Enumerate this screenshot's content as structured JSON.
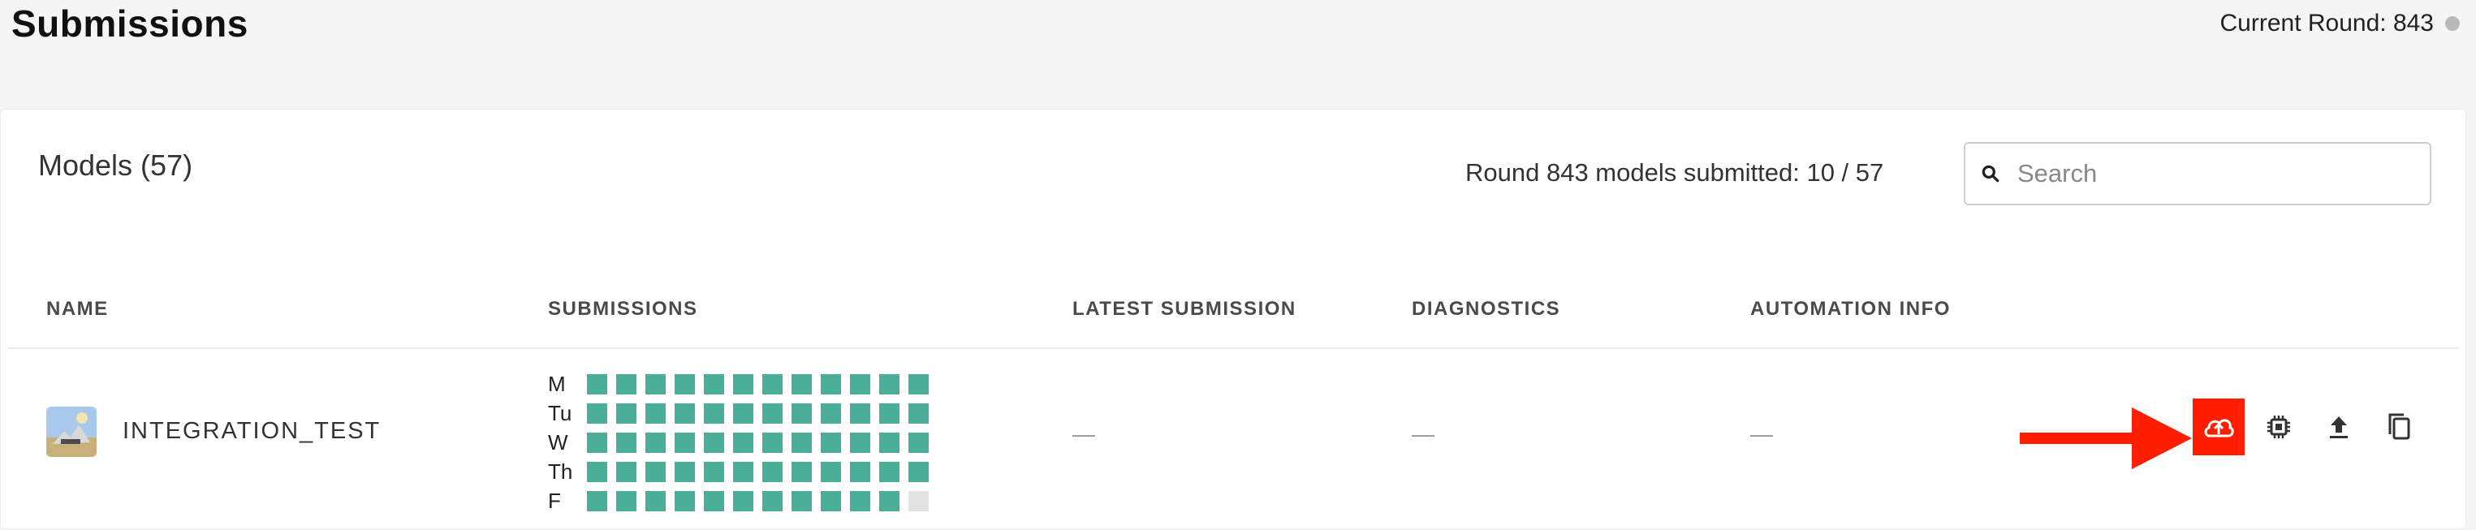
{
  "page": {
    "title": "Submissions"
  },
  "round": {
    "label": "Current Round: 843"
  },
  "models_card": {
    "title": "Models (57)",
    "submitted_status": "Round 843 models submitted: 10 / 57",
    "search": {
      "placeholder": "Search",
      "value": ""
    }
  },
  "table": {
    "columns": {
      "name": "NAME",
      "submissions": "SUBMISSIONS",
      "latest": "LATEST SUBMISSION",
      "diagnostics": "DIAGNOSTICS",
      "automation": "AUTOMATION INFO"
    },
    "rows": [
      {
        "name": "INTEGRATION_TEST",
        "latest_submission": "—",
        "diagnostics": "—",
        "automation_info": "—",
        "submissions": {
          "days": [
            "M",
            "Tu",
            "W",
            "Th",
            "F"
          ],
          "cells_per_day": 12,
          "filled_per_day": [
            12,
            12,
            12,
            12,
            11
          ]
        },
        "actions": [
          "cloud-upload-icon",
          "chip-icon",
          "upload-icon",
          "copy-icon"
        ]
      }
    ]
  },
  "colors": {
    "submitted": "#4aae98",
    "not_submitted": "#e3e3e3",
    "annotation": "#ff1f00"
  }
}
